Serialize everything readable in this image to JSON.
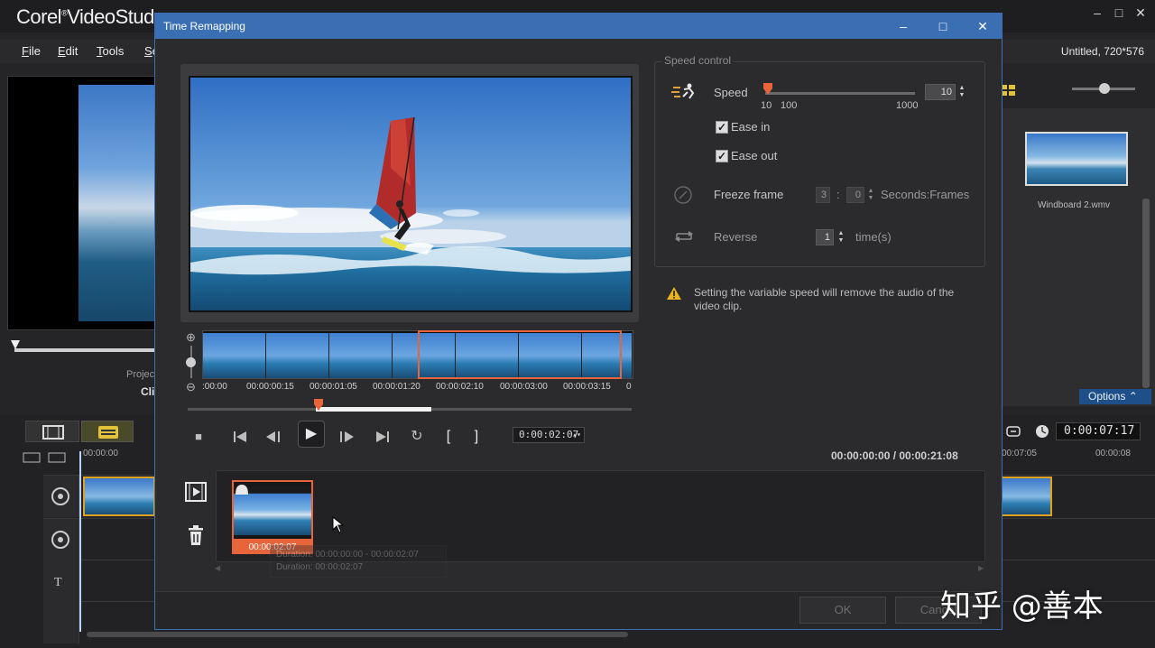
{
  "app": {
    "logo_brand": "Corel",
    "logo_product": "VideoStud",
    "window_controls": [
      "–",
      "□",
      "✕"
    ],
    "project_info": "Untitled, 720*576",
    "menu": [
      {
        "label": "File",
        "mnemonic": "F",
        "rest": "ile"
      },
      {
        "label": "Edit",
        "mnemonic": "E",
        "rest": "dit"
      },
      {
        "label": "Tools",
        "mnemonic": "T",
        "rest": "ools"
      },
      {
        "label": "Se",
        "mnemonic": "S",
        "rest": "e"
      }
    ],
    "left_preview": {
      "project_label": "Projec",
      "clip_label": "Clip"
    },
    "library": {
      "thumb_name": "Windboard 2.wmv"
    },
    "options_button": "Options",
    "timeline": {
      "timecode": "0:00:07:17",
      "ruler_start": "00:00:00",
      "ruler_right": [
        "00:07:05",
        "00:00:08"
      ]
    }
  },
  "dialog": {
    "title": "Time Remapping",
    "controls": {
      "minimize": "–",
      "maximize": "□",
      "close": "✕"
    },
    "filmstrip_times": [
      ":00:00",
      "00:00:00:15",
      "00:00:01:05",
      "00:00:01:20",
      "00:00:02:10",
      "00:00:03:00",
      "00:00:03:15",
      "0"
    ],
    "playback": {
      "stop": "■",
      "prev": "⏮",
      "step_back": "◀I",
      "play": "▶",
      "step_fwd": "I▶",
      "next": "⏭",
      "repeat": "↻",
      "mark_in": "[",
      "mark_out": "]",
      "timecode": "0:00:02:07"
    },
    "duration": "00:00:00:00 / 00:00:21:08",
    "speed_control": {
      "legend": "Speed control",
      "speed_label": "Speed",
      "speed_value": "10",
      "speed_ticks": [
        "10",
        "100",
        "1000"
      ],
      "speed_position": 0.0,
      "ease_in_label": "Ease in",
      "ease_in_checked": true,
      "ease_out_label": "Ease out",
      "ease_out_checked": true,
      "freeze_label": "Freeze frame",
      "freeze_seconds": "3",
      "freeze_separator": ":",
      "freeze_frames": "0",
      "freeze_unit": "Seconds:Frames",
      "reverse_label": "Reverse",
      "reverse_value": "1",
      "reverse_unit": "time(s)"
    },
    "warning": "Setting the variable speed will remove the audio of the video clip.",
    "clip": {
      "time": "00:00:02:07"
    },
    "tooltip": [
      "Duration: 00:00:00:00 - 00:00:02:07",
      "Duration: 00:00:02:07"
    ],
    "footer": {
      "ok": "OK",
      "cancel": "Cancel"
    }
  },
  "watermark": "知乎 @善本",
  "colors": {
    "accent": "#e8643a",
    "titlebar": "#3b6fb3",
    "options": "#1f4f88"
  }
}
